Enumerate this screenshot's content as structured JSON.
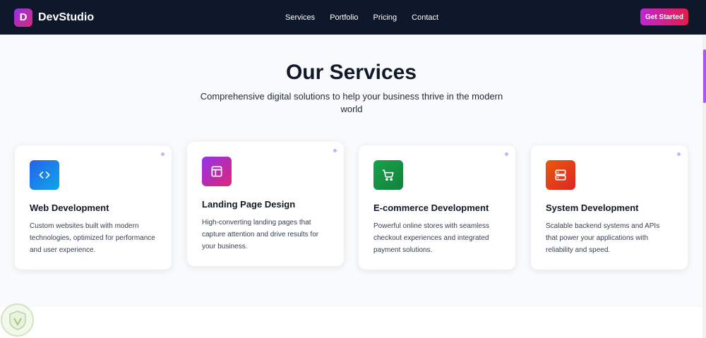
{
  "nav": {
    "logo_letter": "D",
    "brand": "DevStudio",
    "links": [
      "Services",
      "Portfolio",
      "Pricing",
      "Contact"
    ],
    "cta": "Get Started"
  },
  "hero": {
    "title": "Our Services",
    "subtitle": "Comprehensive digital solutions to help your business thrive in the modern world"
  },
  "services": [
    {
      "title": "Web Development",
      "description": "Custom websites built with modern technologies, optimized for performance and user experience.",
      "icon": "code-icon",
      "gradient": [
        "#2563eb",
        "#0ea5e9"
      ]
    },
    {
      "title": "Landing Page Design",
      "description": "High-converting landing pages that capture attention and drive results for your business.",
      "icon": "layout-icon",
      "gradient": [
        "#9333ea",
        "#db2777"
      ]
    },
    {
      "title": "E-commerce Development",
      "description": "Powerful online stores with seamless checkout experiences and integrated payment solutions.",
      "icon": "shopping-cart-icon",
      "gradient": [
        "#16a34a",
        "#15803d"
      ]
    },
    {
      "title": "System Development",
      "description": "Scalable backend systems and APIs that power your applications with reliability and speed.",
      "icon": "server-icon",
      "gradient": [
        "#ea580c",
        "#dc2626"
      ]
    }
  ],
  "colors": {
    "nav_bg": "#0f172a",
    "section_bg": "#f8fafc",
    "accent": "#c026d3"
  }
}
